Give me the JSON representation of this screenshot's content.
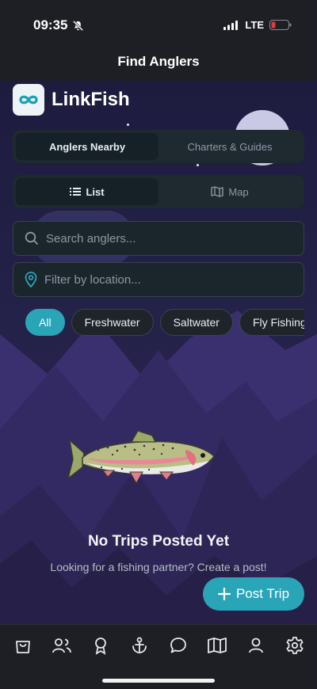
{
  "status_bar": {
    "time": "09:35",
    "network": "LTE"
  },
  "header": {
    "title": "Find Anglers"
  },
  "brand": {
    "name": "LinkFish"
  },
  "mode_tabs": [
    {
      "label": "Anglers Nearby",
      "active": true
    },
    {
      "label": "Charters & Guides",
      "active": false
    }
  ],
  "view_tabs": [
    {
      "label": "List",
      "icon": "list-icon",
      "active": true
    },
    {
      "label": "Map",
      "icon": "map-icon",
      "active": false
    }
  ],
  "search": {
    "placeholder": "Search anglers...",
    "value": ""
  },
  "location_filter": {
    "placeholder": "Filter by location...",
    "value": ""
  },
  "filter_chips": [
    {
      "label": "All",
      "active": true
    },
    {
      "label": "Freshwater",
      "active": false
    },
    {
      "label": "Saltwater",
      "active": false
    },
    {
      "label": "Fly Fishing",
      "active": false
    }
  ],
  "empty_state": {
    "title": "No Trips Posted Yet",
    "subtitle": "Looking for a fishing partner? Create a post!"
  },
  "fab": {
    "label": "Post Trip"
  },
  "tab_bar": [
    {
      "icon": "shopping-bag-icon"
    },
    {
      "icon": "people-icon"
    },
    {
      "icon": "award-icon"
    },
    {
      "icon": "anchor-icon"
    },
    {
      "icon": "chat-icon"
    },
    {
      "icon": "map-icon"
    },
    {
      "icon": "profile-icon"
    },
    {
      "icon": "settings-icon"
    }
  ],
  "colors": {
    "accent": "#2aa5b8",
    "background": "#1e1f24",
    "battery_low": "#e03a3a"
  }
}
